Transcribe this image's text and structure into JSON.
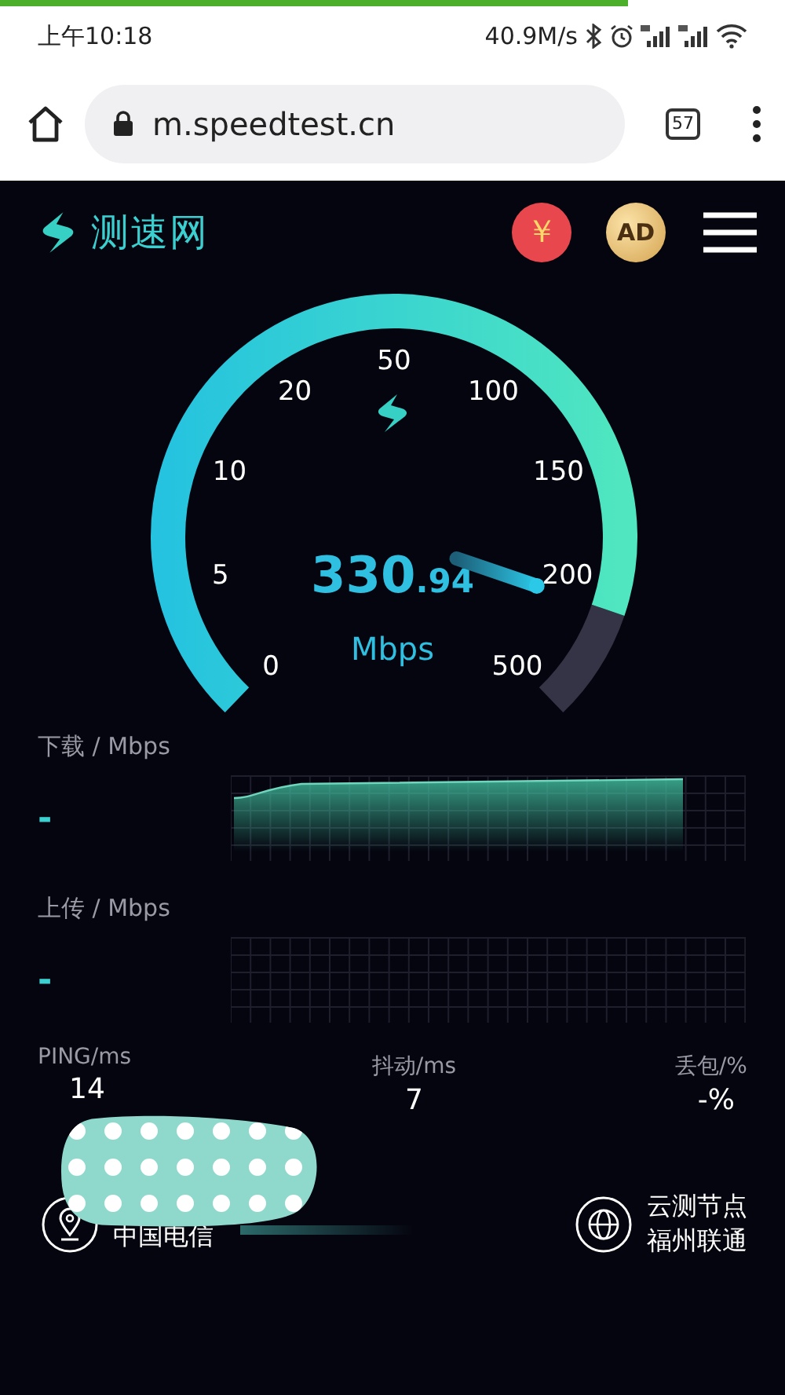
{
  "page_load": {
    "level": 0.8
  },
  "status_bar": {
    "time": "上午10:18",
    "net_speed": "40.9M/s"
  },
  "browser": {
    "url": "m.speedtest.cn",
    "tab_count": "57"
  },
  "header": {
    "brand": "测速网",
    "coin_badge": "￥",
    "ad_badge": "AD"
  },
  "gauge": {
    "scale_labels": [
      "0",
      "5",
      "10",
      "20",
      "50",
      "100",
      "150",
      "200",
      "500"
    ],
    "speed_integer": "330",
    "speed_decimal": ".94",
    "unit": "Mbps"
  },
  "graphs": [
    {
      "label": "下载 / Mbps",
      "value": "-",
      "kind": "filled"
    },
    {
      "label": "上传 / Mbps",
      "value": "-",
      "kind": "empty"
    }
  ],
  "stats": [
    {
      "label": "PING/ms",
      "value": "14"
    },
    {
      "label": "抖动/ms",
      "value": "7"
    },
    {
      "label": "丢包/%",
      "value": "-%"
    }
  ],
  "location": {
    "isp": "中国电信"
  },
  "server": {
    "title": "云测节点",
    "name": "福州联通"
  }
}
